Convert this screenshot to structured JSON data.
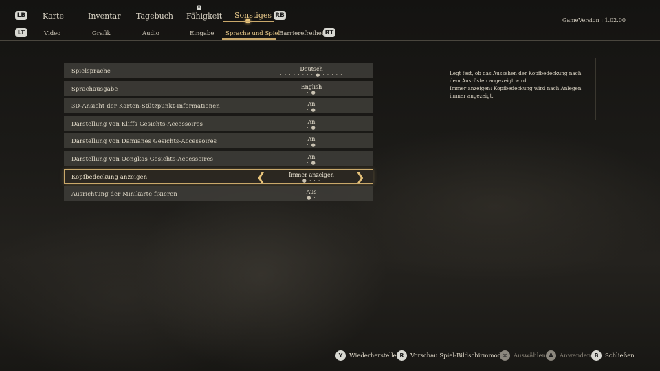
{
  "top_nav": {
    "lb": "LB",
    "rb": "RB",
    "tabs": [
      {
        "label": "Karte"
      },
      {
        "label": "Inventar"
      },
      {
        "label": "Tagebuch"
      },
      {
        "label": "Fähigkeit",
        "badge": "0"
      },
      {
        "label": "Sonstiges"
      }
    ],
    "active_tab": "Sonstiges"
  },
  "sub_nav": {
    "lt": "LT",
    "rt": "RT",
    "tabs": [
      {
        "label": "Video"
      },
      {
        "label": "Grafik"
      },
      {
        "label": "Audio"
      },
      {
        "label": "Eingabe"
      },
      {
        "label": "Sprache und Spiel"
      },
      {
        "label": "Barrierefreiheit"
      }
    ],
    "active_tab": "Sprache und Spiel"
  },
  "version": {
    "label": "GameVersion",
    "separator": ":",
    "value": "1.02.00"
  },
  "settings": [
    {
      "label": "Spielsprache",
      "value": "Deutsch",
      "dots": "· · · · · · · · ● · · · · ·"
    },
    {
      "label": "Sprachausgabe",
      "value": "English",
      "dots": "· ●"
    },
    {
      "label": "3D-Ansicht der Karten-Stützpunkt-Informationen",
      "value": "An",
      "dots": "· ●"
    },
    {
      "label": "Darstellung von Kliffs Gesichts-Accessoires",
      "value": "An",
      "dots": "· ●"
    },
    {
      "label": "Darstellung von Damianes Gesichts-Accessoires",
      "value": "An",
      "dots": "· ●"
    },
    {
      "label": "Darstellung von Oongkas Gesichts-Accessoires",
      "value": "An",
      "dots": "· ●"
    },
    {
      "label": "Kopfbedeckung anzeigen",
      "value": "Immer anzeigen",
      "dots": "● · · ·",
      "selected": true
    },
    {
      "label": "Ausrichtung der Minikarte fixieren",
      "value": "Aus",
      "dots": "● ·"
    }
  ],
  "description": {
    "line1": "Legt fest, ob das Aussehen der Kopfbedeckung nach dem Ausrüsten angezeigt wird.",
    "line2": "Immer anzeigen: Kopfbedeckung wird nach Anlegen immer angezeigt."
  },
  "footer_hints": [
    {
      "glyph": "Y",
      "label": "Wiederherstellen",
      "enabled": true
    },
    {
      "glyph": "R",
      "label": "Vorschau Spiel-Bildschirmmodus",
      "enabled": true
    },
    {
      "glyph": "✕",
      "label": "Auswählen",
      "enabled": false
    },
    {
      "glyph": "A",
      "label": "Anwenden",
      "enabled": false
    },
    {
      "glyph": "B",
      "label": "Schließen",
      "enabled": true
    }
  ],
  "colors": {
    "accent": "#c9a86a",
    "row_bg": "#3e3c38",
    "text": "#e3dccb"
  }
}
